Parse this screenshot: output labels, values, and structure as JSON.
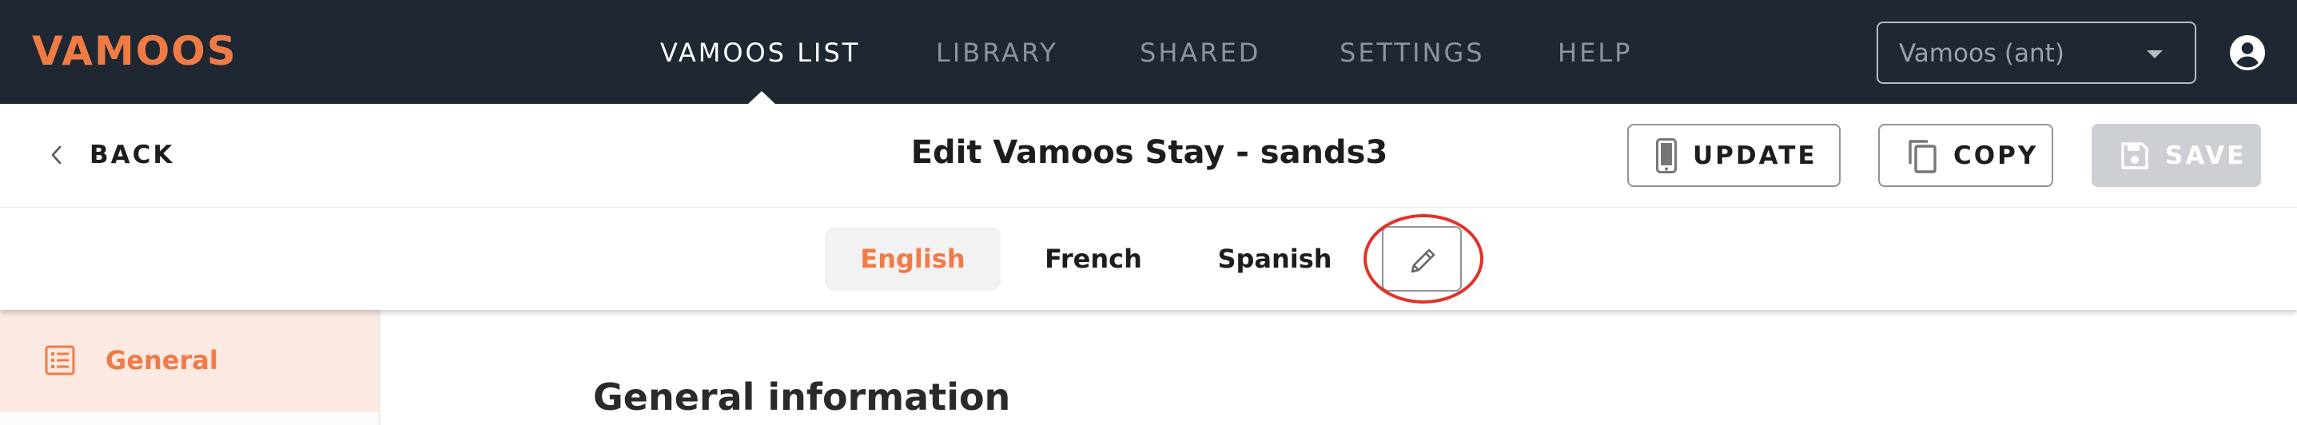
{
  "topbar": {
    "logo": "VAMOOS",
    "nav": [
      {
        "label": "VAMOOS LIST",
        "active": true
      },
      {
        "label": "LIBRARY",
        "active": false
      },
      {
        "label": "SHARED",
        "active": false
      },
      {
        "label": "SETTINGS",
        "active": false
      },
      {
        "label": "HELP",
        "active": false
      }
    ],
    "account_select": {
      "value": "Vamoos (ant)"
    },
    "user_icon": "account-circle-icon"
  },
  "editor": {
    "back_label": "BACK",
    "title": "Edit Vamoos Stay - sands3",
    "buttons": {
      "update": "UPDATE",
      "copy": "COPY",
      "save": "SAVE"
    }
  },
  "languages": {
    "tabs": [
      {
        "label": "English",
        "active": true
      },
      {
        "label": "French",
        "active": false
      },
      {
        "label": "Spanish",
        "active": false
      }
    ],
    "edit_icon": "pencil-icon"
  },
  "sidebar": {
    "items": [
      {
        "label": "General",
        "icon": "list-icon",
        "active": true
      }
    ]
  },
  "main": {
    "section_title": "General information"
  },
  "colors": {
    "topbar_bg": "#1f2832",
    "brand_orange": "#f17b45",
    "nav_inactive": "#8d949c",
    "save_disabled": "#ccd0d4",
    "sidebar_active_bg": "#fbe9e2",
    "annotation_ring": "#e0322a"
  }
}
